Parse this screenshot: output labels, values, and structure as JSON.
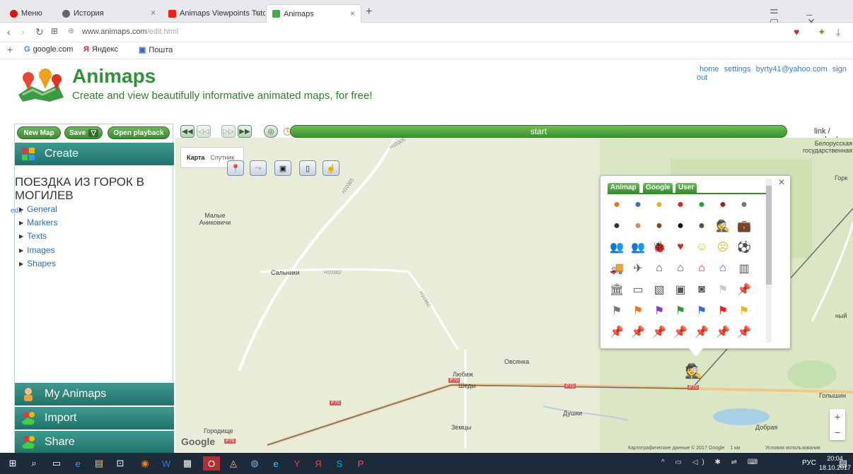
{
  "browser": {
    "tabs": [
      {
        "label": "Меню",
        "active": false
      },
      {
        "label": "История",
        "active": false
      },
      {
        "label": "Animaps Viewpoints Tuto",
        "active": false
      },
      {
        "label": "Animaps",
        "active": true
      }
    ],
    "url_host": "www.animaps.com",
    "url_path": "/edit.html",
    "bookmarks": [
      "google.com",
      "Яндекс",
      "Пошта"
    ]
  },
  "site": {
    "brand": "Animaps",
    "tagline": "Create and view beautifully informative animated maps, for free!",
    "links": [
      "home",
      "settings",
      "byrty41@yahoo.com",
      "sign out"
    ]
  },
  "left": {
    "buttons": {
      "new_map": "New Map",
      "save": "Save",
      "open_playback": "Open playback"
    },
    "create": "Create",
    "map_title": "ПОЕЗДКА ИЗ ГОРОК В МОГИЛЕВ",
    "edit": "edit",
    "tree": [
      "General",
      "Markers",
      "Texts",
      "Images",
      "Shapes"
    ],
    "my_animaps": "My Animaps",
    "import": "Import",
    "share": "Share"
  },
  "toolbar": {
    "progress_label": "start",
    "link_embed": "link / embed"
  },
  "map": {
    "type_tabs": [
      "Карта",
      "Спутник"
    ],
    "labels": [
      "Белорусская государственная",
      "Горк",
      "Малые Аниковичи",
      "Сальники",
      "Овсянка",
      "Любиж",
      "Шеды",
      "Голышин",
      "Душки",
      "Добрая",
      "Городище",
      "Земцы",
      "ный"
    ],
    "road_labels": [
      "H10305",
      "H10305",
      "H10362",
      "H10362",
      "P70",
      "P70",
      "P70",
      "P70",
      "P70"
    ],
    "google": "Google",
    "attribution": "Картографические данные © 2017 Google",
    "scale": "1 км",
    "terms": "Условия использования"
  },
  "picker": {
    "tabs": [
      "Animap",
      "Google",
      "User"
    ],
    "icons": [
      "person-orange-icon",
      "person-blue-icon",
      "person-yellow-icon",
      "person-red-icon",
      "person-green-icon",
      "person-darkred-icon",
      "person-gray-icon",
      "person-dark-icon",
      "person-tan-icon",
      "person-brown-icon",
      "person-black-icon",
      "person-military-icon",
      "spy-icon",
      "briefcase-icon",
      "group-icon",
      "group2-icon",
      "bug-icon",
      "heart-icon",
      "smile-icon",
      "sad-icon",
      "soccer-ball-icon",
      "truck-icon",
      "airplane-icon",
      "monument-icon",
      "house-icon",
      "house-red-icon",
      "house-blue-icon",
      "skyscraper-icon",
      "bank-icon",
      "id-card-icon",
      "box-icon",
      "photo-icon",
      "camera-icon",
      "flag-white-icon",
      "pin-white-icon",
      "flag-gray-icon",
      "flag-orange-icon",
      "flag-purple-icon",
      "flag-green-icon",
      "flag-blue-icon",
      "flag-red-icon",
      "flag-yellow-icon",
      "pin-black-icon",
      "pin-orange-icon",
      "pin-purple-icon",
      "pin-green-icon",
      "pin-blue-icon",
      "pin-red-icon",
      "pin-yellow-icon"
    ]
  },
  "taskbar": {
    "lang": "РУС",
    "time": "20:04",
    "date": "18.10.2017"
  }
}
